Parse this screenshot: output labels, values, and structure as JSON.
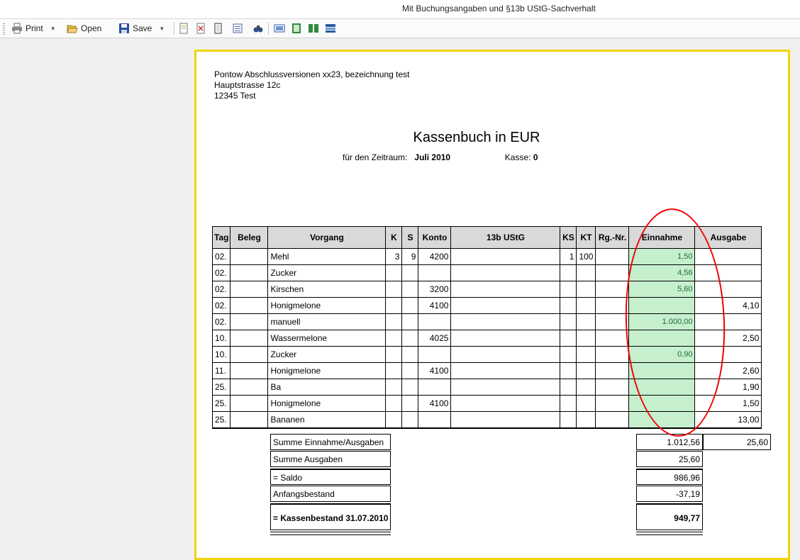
{
  "window": {
    "title": "Mit Buchungsangaben und §13b UStG-Sachverhalt"
  },
  "toolbar": {
    "print_label": "Print",
    "open_label": "Open",
    "save_label": "Save"
  },
  "report": {
    "address": [
      "Pontow Abschlussversionen xx23, bezeichnung test",
      "Hauptstrasse 12c",
      "12345 Test"
    ],
    "title": "Kassenbuch in EUR",
    "period_label": "für den Zeitraum:",
    "period_value": "Juli 2010",
    "kasse_label": "Kasse:",
    "kasse_value": "0",
    "headers": [
      "Tag",
      "Beleg",
      "Vorgang",
      "K",
      "S",
      "Konto",
      "13b UStG",
      "KS",
      "KT",
      "Rg.-Nr.",
      "Einnahme",
      "Ausgabe"
    ],
    "rows": [
      {
        "tag": "02.",
        "beleg": "",
        "vorgang": "Mehl",
        "k": "3",
        "s": "9",
        "konto": "4200",
        "ustg": "",
        "ks": "1",
        "kt": "100",
        "rg": "",
        "einnahme": "1,50",
        "ausgabe": ""
      },
      {
        "tag": "02.",
        "beleg": "",
        "vorgang": "Zucker",
        "k": "",
        "s": "",
        "konto": "",
        "ustg": "",
        "ks": "",
        "kt": "",
        "rg": "",
        "einnahme": "4,56",
        "ausgabe": ""
      },
      {
        "tag": "02.",
        "beleg": "",
        "vorgang": "Kirschen",
        "k": "",
        "s": "",
        "konto": "3200",
        "ustg": "",
        "ks": "",
        "kt": "",
        "rg": "",
        "einnahme": "5,60",
        "ausgabe": ""
      },
      {
        "tag": "02.",
        "beleg": "",
        "vorgang": "Honigmelone",
        "k": "",
        "s": "",
        "konto": "4100",
        "ustg": "",
        "ks": "",
        "kt": "",
        "rg": "",
        "einnahme": "",
        "ausgabe": "4,10"
      },
      {
        "tag": "02.",
        "beleg": "",
        "vorgang": "manuell",
        "k": "",
        "s": "",
        "konto": "",
        "ustg": "",
        "ks": "",
        "kt": "",
        "rg": "",
        "einnahme": "1.000,00",
        "ausgabe": ""
      },
      {
        "tag": "10.",
        "beleg": "",
        "vorgang": "Wassermelone",
        "k": "",
        "s": "",
        "konto": "4025",
        "ustg": "",
        "ks": "",
        "kt": "",
        "rg": "",
        "einnahme": "",
        "ausgabe": "2,50"
      },
      {
        "tag": "10.",
        "beleg": "",
        "vorgang": "Zucker",
        "k": "",
        "s": "",
        "konto": "",
        "ustg": "",
        "ks": "",
        "kt": "",
        "rg": "",
        "einnahme": "0,90",
        "ausgabe": ""
      },
      {
        "tag": "11.",
        "beleg": "",
        "vorgang": "Honigmelone",
        "k": "",
        "s": "",
        "konto": "4100",
        "ustg": "",
        "ks": "",
        "kt": "",
        "rg": "",
        "einnahme": "",
        "ausgabe": "2,60"
      },
      {
        "tag": "25.",
        "beleg": "",
        "vorgang": "Ba",
        "k": "",
        "s": "",
        "konto": "",
        "ustg": "",
        "ks": "",
        "kt": "",
        "rg": "",
        "einnahme": "",
        "ausgabe": "1,90"
      },
      {
        "tag": "25.",
        "beleg": "",
        "vorgang": "Honigmelone",
        "k": "",
        "s": "",
        "konto": "4100",
        "ustg": "",
        "ks": "",
        "kt": "",
        "rg": "",
        "einnahme": "",
        "ausgabe": "1,50"
      },
      {
        "tag": "25.",
        "beleg": "",
        "vorgang": "Bananen",
        "k": "",
        "s": "",
        "konto": "",
        "ustg": "",
        "ks": "",
        "kt": "",
        "rg": "",
        "einnahme": "",
        "ausgabe": "13,00"
      }
    ],
    "summary": {
      "summe_ea_label": "Summe Einnahme/Ausgaben",
      "summe_ea_einnahme": "1.012,56",
      "summe_ea_ausgabe": "25,60",
      "summe_ausgaben_label": "Summe Ausgaben",
      "summe_ausgaben_value": "25,60",
      "saldo_label": "= Saldo",
      "saldo_value": "986,96",
      "anfang_label": "Anfangsbestand",
      "anfang_value": "-37,19",
      "bestand_label": "= Kassenbestand 31.07.2010",
      "bestand_value": "949,77"
    }
  },
  "colors": {
    "highlight_column": "#c6efce",
    "highlight_text": "#1f6b3a",
    "page_border": "#f2d40a",
    "annotation": "#e00000"
  }
}
